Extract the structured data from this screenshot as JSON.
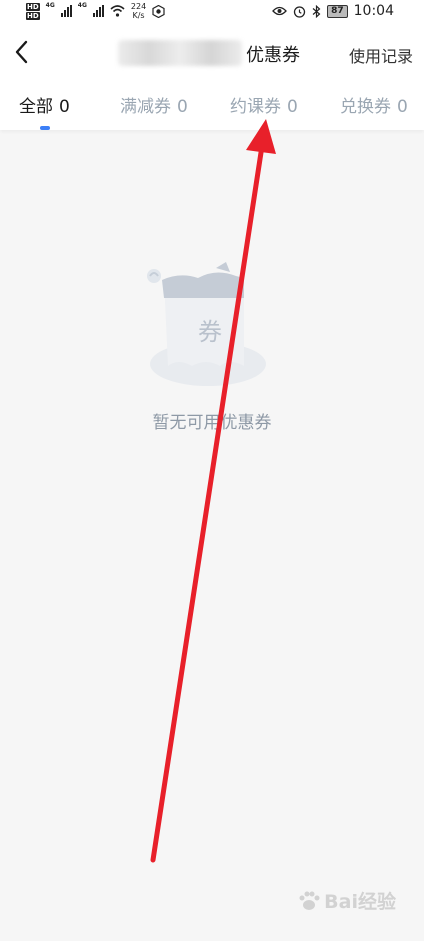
{
  "status_bar": {
    "network_speed": "224",
    "network_unit": "K/s",
    "net_gen_1": "4G",
    "net_gen_2": "4G",
    "hd_label": "HD",
    "battery": "87",
    "time": "10:04"
  },
  "navbar": {
    "title": "优惠券",
    "record_label": "使用记录"
  },
  "tabs": [
    {
      "label": "全部",
      "count": "0",
      "active": true
    },
    {
      "label": "满减券",
      "count": "0",
      "active": false
    },
    {
      "label": "约课券",
      "count": "0",
      "active": false
    },
    {
      "label": "兑换券",
      "count": "0",
      "active": false
    }
  ],
  "empty_state": {
    "illustration_text": "券",
    "message": "暂无可用优惠券"
  },
  "watermark": {
    "text": "Bai经验"
  },
  "colors": {
    "accent": "#3c7ff7",
    "annotation_arrow": "#e8202a",
    "inactive_tab": "#9aa6b2",
    "background": "#f6f6f6"
  },
  "icons": [
    "back-icon",
    "signal-icon",
    "wifi-icon",
    "eye-icon",
    "alarm-icon",
    "bluetooth-icon",
    "battery-icon",
    "coupon-illustration"
  ]
}
